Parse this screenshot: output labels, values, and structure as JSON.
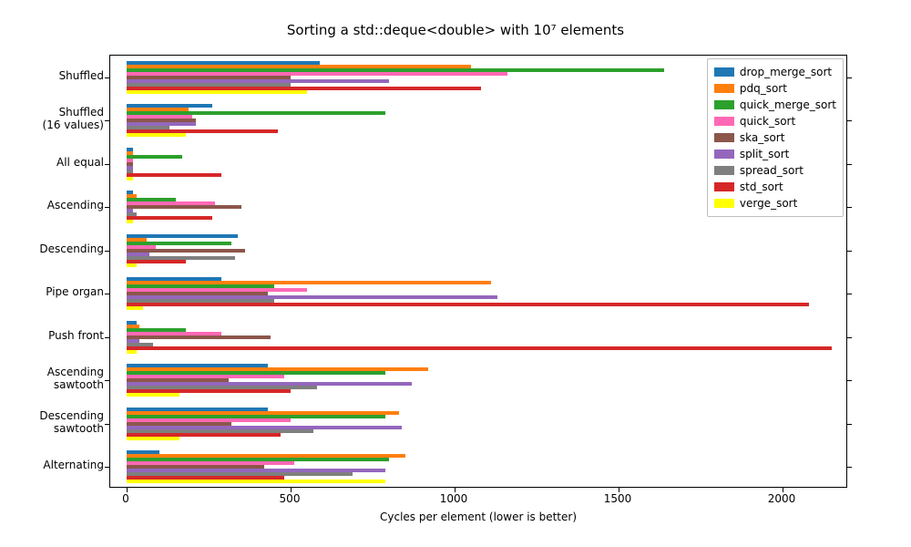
{
  "chart_data": {
    "type": "bar",
    "title": "Sorting a std::deque<double> with 10⁷ elements",
    "xlabel": "Cycles per element (lower is better)",
    "ylabel": "",
    "xlim": [
      -50,
      2200
    ],
    "xticks": [
      0,
      500,
      1000,
      1500,
      2000
    ],
    "categories": [
      "Shuffled",
      "Shuffled\n(16 values)",
      "All equal",
      "Ascending",
      "Descending",
      "Pipe organ",
      "Push front",
      "Ascending\nsawtooth",
      "Descending\nsawtooth",
      "Alternating"
    ],
    "series": [
      {
        "name": "drop_merge_sort",
        "color": "#1f77b4",
        "values": [
          590,
          260,
          20,
          20,
          340,
          290,
          30,
          430,
          430,
          100
        ]
      },
      {
        "name": "pdq_sort",
        "color": "#ff7f0e",
        "values": [
          1050,
          190,
          20,
          30,
          60,
          1110,
          40,
          920,
          830,
          850
        ]
      },
      {
        "name": "quick_merge_sort",
        "color": "#2ca02c",
        "values": [
          1640,
          790,
          170,
          150,
          320,
          450,
          180,
          790,
          790,
          800
        ]
      },
      {
        "name": "quick_sort",
        "color": "#ff69b4",
        "values": [
          1160,
          200,
          20,
          270,
          90,
          550,
          290,
          480,
          500,
          510
        ]
      },
      {
        "name": "ska_sort",
        "color": "#8c564b",
        "values": [
          500,
          210,
          20,
          350,
          360,
          430,
          440,
          310,
          320,
          420
        ]
      },
      {
        "name": "split_sort",
        "color": "#9467bd",
        "values": [
          800,
          210,
          20,
          20,
          70,
          1130,
          40,
          870,
          840,
          790
        ]
      },
      {
        "name": "spread_sort",
        "color": "#7f7f7f",
        "values": [
          500,
          130,
          20,
          30,
          330,
          450,
          80,
          580,
          570,
          690
        ]
      },
      {
        "name": "std_sort",
        "color": "#d62728",
        "values": [
          1080,
          460,
          290,
          260,
          180,
          2080,
          2150,
          500,
          470,
          480
        ]
      },
      {
        "name": "verge_sort",
        "color": "#ffff00",
        "values": [
          550,
          180,
          20,
          20,
          30,
          50,
          30,
          160,
          160,
          790
        ]
      }
    ],
    "legend_position": "upper right"
  }
}
